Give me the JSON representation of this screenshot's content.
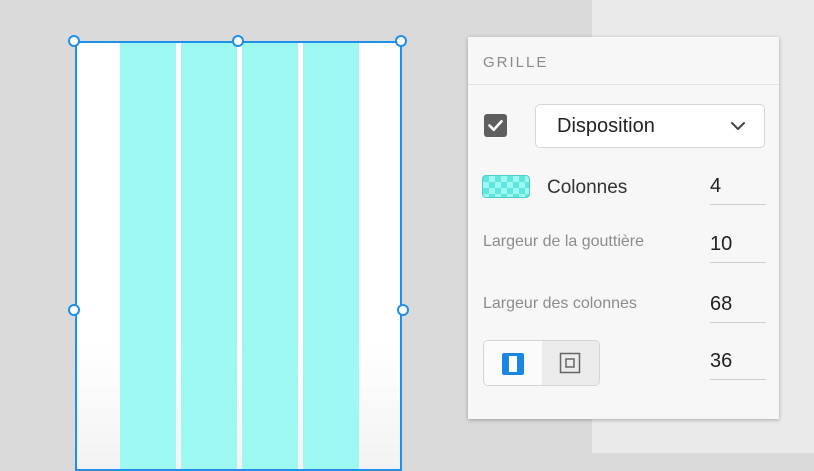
{
  "canvas": {
    "column_count": 4,
    "column_color": "#9df8f2",
    "selection_color": "#1f8fe8"
  },
  "panel": {
    "section_title": "GRILLE",
    "layout_checkbox_checked": true,
    "layout_dropdown": {
      "selected": "Disposition"
    },
    "columns": {
      "label": "Colonnes",
      "value": "4"
    },
    "gutter": {
      "label": "Largeur de la gouttière",
      "value": "10"
    },
    "column_width": {
      "label": "Largeur des colonnes",
      "value": "68"
    },
    "margins": {
      "value": "36",
      "mode_buttons": [
        {
          "icon": "linked-margins-icon",
          "active": true
        },
        {
          "icon": "different-margins-icon",
          "active": false
        }
      ]
    }
  }
}
